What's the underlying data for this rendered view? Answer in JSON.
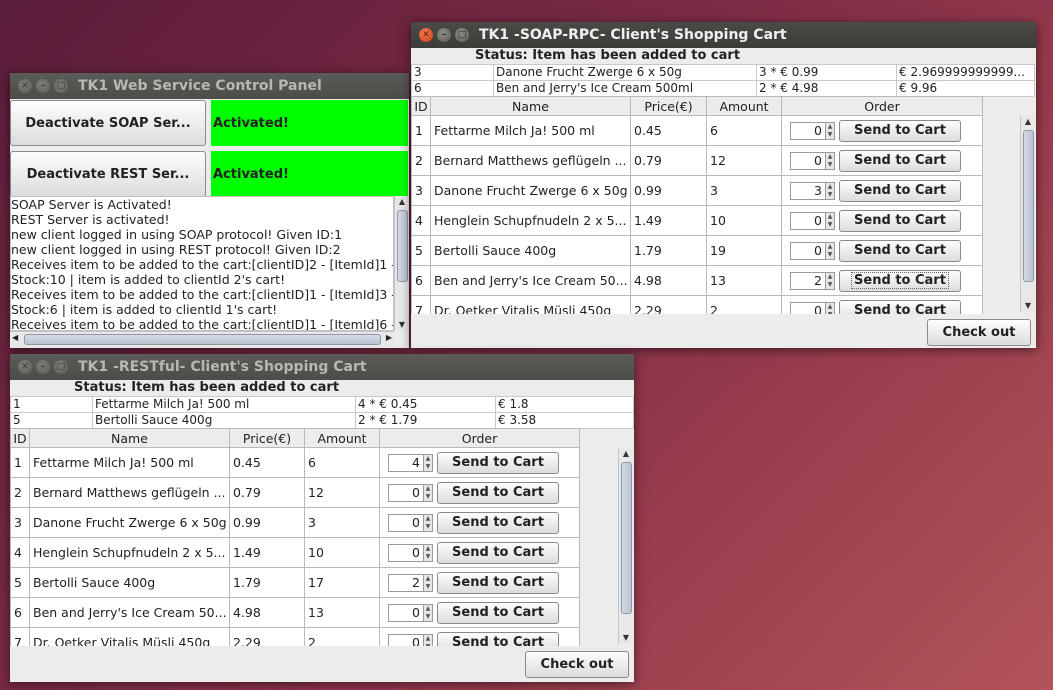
{
  "control_panel": {
    "title": "TK1 Web Service Control Panel",
    "soap_button": "Deactivate SOAP Ser...",
    "soap_status": "Activated!",
    "rest_button": "Deactivate REST Ser...",
    "rest_status": "Activated!",
    "log": [
      "SOAP Server is Activated!",
      "REST Server is activated!",
      "new client logged in using SOAP protocol! Given ID:1",
      "new client logged in using REST protocol! Given ID:2",
      "Receives item to be added to the cart:[clientID]2 - [ItemId]1 -",
      "Stock:10 | item is added to clientId 2's cart!",
      "Receives item to be added to the cart:[clientID]1 - [ItemId]3 -",
      "Stock:6 | item is added to clientId 1's cart!",
      "Receives item to be added to the cart:[clientID]1 - [ItemId]6 -"
    ]
  },
  "soap_cart": {
    "title": "TK1 -SOAP-RPC- Client's Shopping Cart",
    "status": "Status: Item has been added to cart",
    "cart_rows": [
      [
        "3",
        "Danone Frucht Zwerge 6 x 50g",
        "3 * € 0.99",
        "€ 2.969999999999..."
      ],
      [
        "6",
        "Ben and Jerry's Ice Cream 500ml",
        "2 * € 4.98",
        "€ 9.96"
      ]
    ],
    "headers": {
      "id": "ID",
      "name": "Name",
      "price": "Price(€)",
      "amount": "Amount",
      "order": "Order"
    },
    "products": [
      {
        "id": "1",
        "name": "Fettarme Milch Ja! 500 ml",
        "price": "0.45",
        "amount": "6",
        "qty": "0"
      },
      {
        "id": "2",
        "name": "Bernard Matthews geflügeln ...",
        "price": "0.79",
        "amount": "12",
        "qty": "0"
      },
      {
        "id": "3",
        "name": "Danone Frucht Zwerge 6 x 50g",
        "price": "0.99",
        "amount": "3",
        "qty": "3"
      },
      {
        "id": "4",
        "name": "Henglein Schupfnudeln 2 x 5...",
        "price": "1.49",
        "amount": "10",
        "qty": "0"
      },
      {
        "id": "5",
        "name": "Bertolli Sauce 400g",
        "price": "1.79",
        "amount": "19",
        "qty": "0"
      },
      {
        "id": "6",
        "name": "Ben and Jerry's Ice Cream 50...",
        "price": "4.98",
        "amount": "13",
        "qty": "2"
      },
      {
        "id": "7",
        "name": "Dr. Oetker Vitalis Müsli 450g",
        "price": "2.29",
        "amount": "2",
        "qty": "0"
      }
    ],
    "send_label": "Send to Cart",
    "checkout_label": "Check out"
  },
  "rest_cart": {
    "title": "TK1 -RESTful- Client's Shopping Cart",
    "status": "Status: Item has been added to cart",
    "cart_rows": [
      [
        "1",
        "Fettarme Milch Ja! 500 ml",
        "4 * € 0.45",
        "€ 1.8"
      ],
      [
        "5",
        "Bertolli Sauce 400g",
        "2 * € 1.79",
        "€ 3.58"
      ]
    ],
    "headers": {
      "id": "ID",
      "name": "Name",
      "price": "Price(€)",
      "amount": "Amount",
      "order": "Order"
    },
    "products": [
      {
        "id": "1",
        "name": "Fettarme Milch Ja! 500 ml",
        "price": "0.45",
        "amount": "6",
        "qty": "4"
      },
      {
        "id": "2",
        "name": "Bernard Matthews geflügeln ...",
        "price": "0.79",
        "amount": "12",
        "qty": "0"
      },
      {
        "id": "3",
        "name": "Danone Frucht Zwerge 6 x 50g",
        "price": "0.99",
        "amount": "3",
        "qty": "0"
      },
      {
        "id": "4",
        "name": "Henglein Schupfnudeln 2 x 5...",
        "price": "1.49",
        "amount": "10",
        "qty": "0"
      },
      {
        "id": "5",
        "name": "Bertolli Sauce 400g",
        "price": "1.79",
        "amount": "17",
        "qty": "2"
      },
      {
        "id": "6",
        "name": "Ben and Jerry's Ice Cream 50...",
        "price": "4.98",
        "amount": "13",
        "qty": "0"
      },
      {
        "id": "7",
        "name": "Dr. Oetker Vitalis Müsli 450g",
        "price": "2.29",
        "amount": "2",
        "qty": "0"
      }
    ],
    "send_label": "Send to Cart",
    "checkout_label": "Check out"
  },
  "icons": {
    "close": "close-icon",
    "minimize": "minimize-icon",
    "maximize": "maximize-icon"
  },
  "colors": {
    "activated": "#00ff00",
    "title_active": "#3c3c39",
    "close_button": "#e2522a"
  }
}
